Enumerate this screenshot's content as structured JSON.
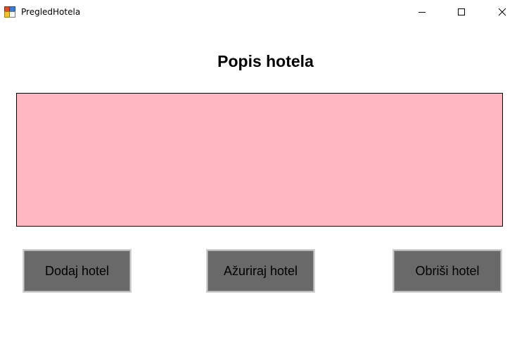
{
  "window": {
    "title": "PregledHotela",
    "icon": "winforms-app-icon",
    "controls": {
      "minimize": "minimize-icon",
      "maximize": "maximize-icon",
      "close": "close-icon"
    }
  },
  "main": {
    "heading": "Popis hotela",
    "list_background": "#ffb6c1",
    "buttons": {
      "add": "Dodaj hotel",
      "edit": "Ažuriraj hotel",
      "delete": "Obriši hotel"
    },
    "button_background": "#696969"
  }
}
